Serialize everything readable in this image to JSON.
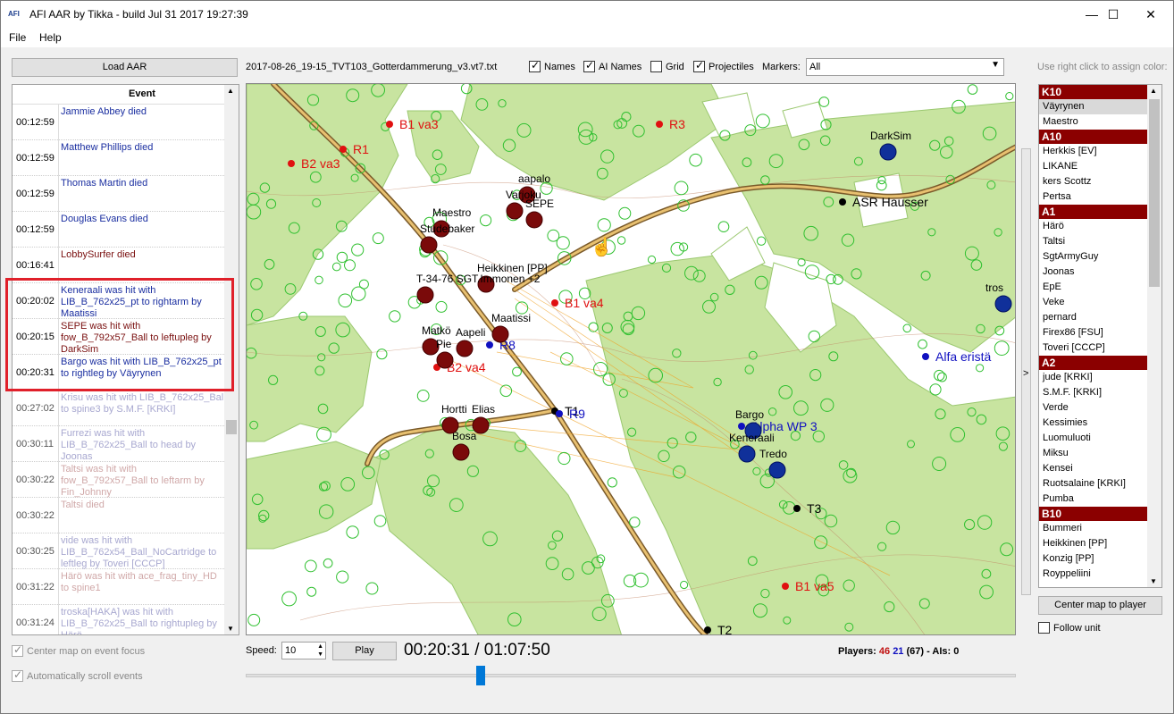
{
  "window": {
    "logo": "AFI",
    "title": "AFI AAR by Tikka - build Jul 31 2017 19:27:39",
    "minimize": "—",
    "maximize": "☐",
    "close": "✕"
  },
  "menu": [
    "File",
    "Help"
  ],
  "toolbar": {
    "load_label": "Load AAR",
    "filename": "2017-08-26_19-15_TVT103_Gotterdammerung_v3.vt7.txt",
    "names": {
      "label": "Names",
      "checked": true
    },
    "ai_names": {
      "label": "AI Names",
      "checked": true
    },
    "grid": {
      "label": "Grid",
      "checked": false
    },
    "projectiles": {
      "label": "Projectiles",
      "checked": true
    },
    "markers_label": "Markers:",
    "markers_value": "All",
    "color_hint": "Use right click to assign color:"
  },
  "events": {
    "header": "Event",
    "rows": [
      {
        "time": "00:12:59",
        "text": "Jammie Abbey died",
        "color": "#1a2ea0"
      },
      {
        "time": "00:12:59",
        "text": "Matthew Phillips died",
        "color": "#1a2ea0"
      },
      {
        "time": "00:12:59",
        "text": "Thomas Martin died",
        "color": "#1a2ea0"
      },
      {
        "time": "00:12:59",
        "text": "Douglas Evans died",
        "color": "#1a2ea0"
      },
      {
        "time": "00:16:41",
        "text": "LobbySurfer died",
        "color": "#7a1010"
      },
      {
        "time": "00:20:02",
        "text": "Keneraali was hit with LIB_B_762x25_pt to rightarm by Maatissi",
        "color": "#1a2ea0"
      },
      {
        "time": "00:20:15",
        "text": "SEPE was hit with fow_B_792x57_Ball to leftupleg by DarkSim",
        "color": "#7a1010"
      },
      {
        "time": "00:20:31",
        "text": "Bargo was hit with LIB_B_762x25_pt to rightleg by Väyrynen",
        "color": "#1a2ea0"
      },
      {
        "time": "00:27:02",
        "text": "Krisu was hit with LIB_B_762x25_Ball to spine3 by S.M.F. [KRKI]",
        "color": "#a8a8d0"
      },
      {
        "time": "00:30:11",
        "text": "Furrezi was hit with LIB_B_762x25_Ball to head by Joonas",
        "color": "#a8a8d0"
      },
      {
        "time": "00:30:22",
        "text": "Taltsi was hit with fow_B_792x57_Ball to leftarm by Fin_Johnny",
        "color": "#d0a8a8"
      },
      {
        "time": "00:30:22",
        "text": "Taltsi died",
        "color": "#d0a8a8"
      },
      {
        "time": "00:30:25",
        "text": "vide was hit with LIB_B_762x54_Ball_NoCartridge to leftleg by Toveri [CCCP]",
        "color": "#a8a8d0"
      },
      {
        "time": "00:31:22",
        "text": "Härö was hit with ace_frag_tiny_HD to spine1",
        "color": "#d0a8a8"
      },
      {
        "time": "00:31:24",
        "text": "troska[HAKA] was hit with LIB_B_762x25_Ball to rightupleg by Härö",
        "color": "#a8a8d0"
      }
    ]
  },
  "options": {
    "center_on_event": "Center map on event focus",
    "auto_scroll": "Automatically scroll events"
  },
  "playback": {
    "speed_label": "Speed:",
    "speed_value": "10",
    "play_label": "Play",
    "time": "00:20:31 / 01:07:50",
    "progress": 0.302,
    "players_label": "Players:",
    "players_red": "46",
    "players_blue": "21",
    "players_total": "(67)",
    "ais": "- AIs: 0"
  },
  "units": {
    "center_label": "Center map to player",
    "follow_label": "Follow unit",
    "expand": ">",
    "groups": [
      {
        "name": "K10",
        "members": [
          "Väyrynen",
          "Maestro"
        ]
      },
      {
        "name": "A10",
        "members": [
          "Herkkis [EV]",
          "LIKANE",
          "kers Scottz",
          "Pertsa"
        ]
      },
      {
        "name": "A1",
        "members": [
          "Härö",
          "Taltsi",
          "SgtArmyGuy",
          "Joonas",
          "EpE",
          "Veke",
          "pernard",
          "Firex86 [FSU]",
          "Toveri [CCCP]"
        ]
      },
      {
        "name": "A2",
        "members": [
          "jude [KRKI]",
          "S.M.F. [KRKI]",
          "Verde",
          "Kessimies",
          "Luomuluoti",
          "Miksu",
          "Kensei",
          "Ruotsalaine [KRKI]",
          "Pumba"
        ]
      },
      {
        "name": "B10",
        "members": [
          "Bummeri",
          "Heikkinen [PP]",
          "Konzig [PP]",
          "Royppeliini"
        ]
      }
    ]
  },
  "map": {
    "markers": [
      {
        "label": "B1 va3",
        "color": "#e01010"
      },
      {
        "label": "R3",
        "color": "#e01010"
      },
      {
        "label": "B2 va3",
        "color": "#e01010"
      },
      {
        "label": "R1",
        "color": "#e01010"
      },
      {
        "label": "B1 va4",
        "color": "#e01010"
      },
      {
        "label": "B2 va4",
        "color": "#e01010"
      },
      {
        "label": "B1 va5",
        "color": "#e01010"
      },
      {
        "label": "ASR Hausser",
        "color": "#000000"
      },
      {
        "label": "T1",
        "color": "#000000"
      },
      {
        "label": "T3",
        "color": "#000000"
      },
      {
        "label": "T2",
        "color": "#000000"
      },
      {
        "label": "R9",
        "color": "#1010c0"
      },
      {
        "label": "R8",
        "color": "#1010c0"
      },
      {
        "label": "Alfa eristä",
        "color": "#1010c0"
      },
      {
        "label": "Alpha WP 3",
        "color": "#1010c0"
      }
    ],
    "players_red": [
      "aapalo",
      "Varjoku",
      "SEPE",
      "Maestro",
      "Studebaker",
      "Heikkinen [PP]",
      "T-34-76 SGT.Immonen +2",
      "Maatissi",
      "Matkö",
      "Aapeli",
      "Pie",
      "Bosa",
      "Hortti",
      "Elias"
    ],
    "players_blue": [
      "DarkSim",
      "Bargo",
      "Keneraali",
      "Tredo",
      "tros"
    ]
  }
}
